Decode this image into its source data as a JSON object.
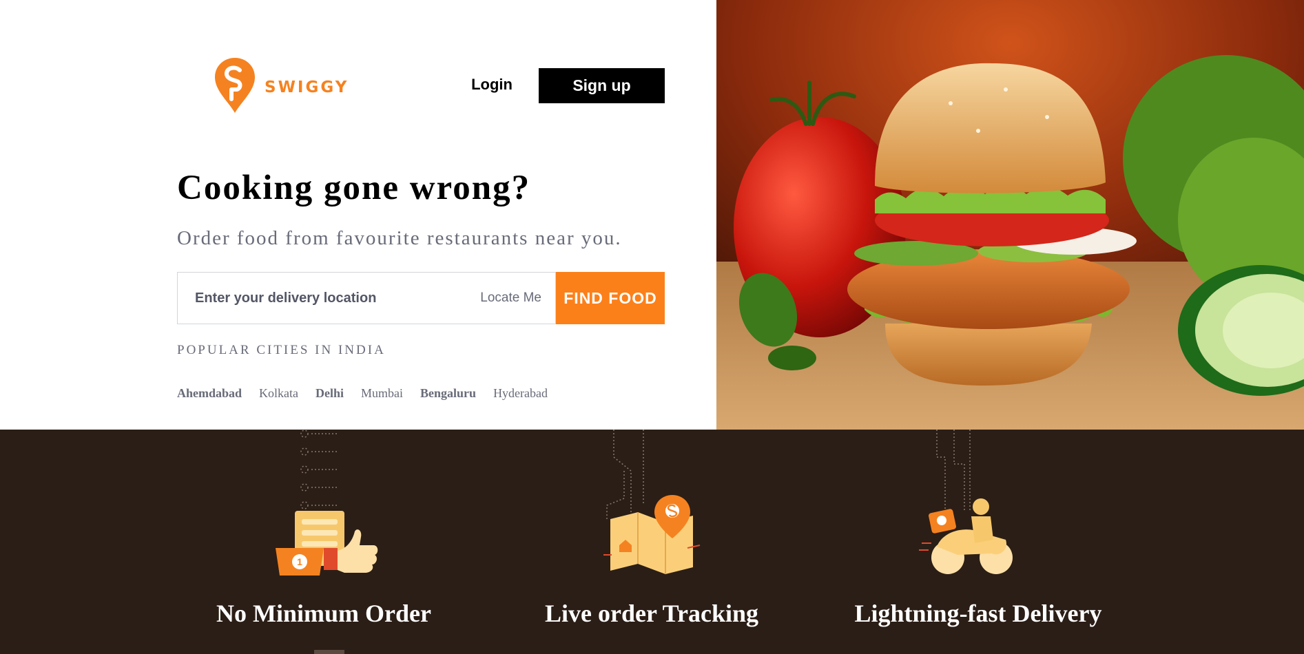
{
  "brand": {
    "name": "SWIGGY",
    "color": "#fc8019"
  },
  "header": {
    "login_label": "Login",
    "signup_label": "Sign up"
  },
  "hero": {
    "headline": "Cooking gone wrong?",
    "subline": "Order food from favourite restaurants near you."
  },
  "search": {
    "placeholder": "Enter your delivery location",
    "locate_label": "Locate Me",
    "find_label": "FIND FOOD"
  },
  "popular": {
    "title": "POPULAR CITIES IN INDIA",
    "cities": [
      {
        "name": "Ahemdabad",
        "bold": true
      },
      {
        "name": "Kolkata",
        "bold": false
      },
      {
        "name": "Delhi",
        "bold": true
      },
      {
        "name": "Mumbai",
        "bold": false
      },
      {
        "name": "Bengaluru",
        "bold": true
      },
      {
        "name": "Hyderabad",
        "bold": false
      }
    ]
  },
  "features": [
    {
      "label": "No Minimum Order",
      "icon": "thumbs-up-order-icon"
    },
    {
      "label": "Live order Tracking",
      "icon": "map-location-icon"
    },
    {
      "label": "Lightning-fast Delivery",
      "icon": "delivery-scooter-icon"
    }
  ],
  "colors": {
    "dark_bg": "#2b1e16",
    "accent": "#fc8019",
    "text_gray": "#686b78"
  }
}
